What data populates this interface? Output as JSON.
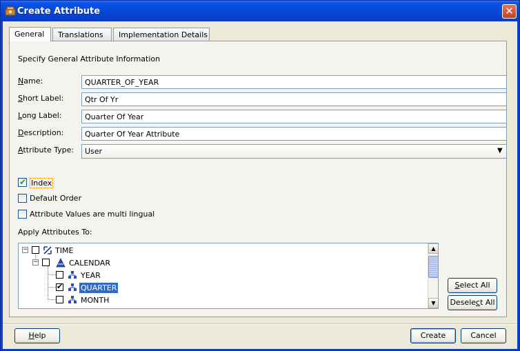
{
  "window": {
    "title": "Create Attribute",
    "close_label": "✕"
  },
  "tabs": [
    {
      "label": "General",
      "active": true
    },
    {
      "label": "Translations",
      "active": false
    },
    {
      "label": "Implementation Details",
      "active": false
    }
  ],
  "section_title": "Specify General Attribute Information",
  "fields": {
    "name": {
      "label_mn": "N",
      "label_rest": "ame:",
      "value": "QUARTER_OF_YEAR"
    },
    "short_label": {
      "label_mn": "S",
      "label_rest": "hort Label:",
      "value": "Qtr Of Yr"
    },
    "long_label": {
      "label_mn": "L",
      "label_rest": "ong Label:",
      "value": "Quarter Of Year"
    },
    "description": {
      "label_mn": "D",
      "label_rest": "escription:",
      "value": "Quarter Of Year Attribute"
    },
    "attribute_type": {
      "label_mn": "A",
      "label_rest": "ttribute Type:",
      "value": "User"
    }
  },
  "checkboxes": {
    "index": {
      "label_mn": "I",
      "label_rest": "ndex",
      "checked": true
    },
    "default_order": {
      "label_pre": "Default ",
      "label_mn": "O",
      "label_rest": "rder",
      "checked": false
    },
    "multilingual": {
      "label_pre": "Attribute ",
      "label_mn": "V",
      "label_rest": "alues are multi lingual",
      "checked": false
    }
  },
  "apply_label": "Apply Attributes To:",
  "tree": {
    "nodes": [
      {
        "label": "TIME",
        "icon": "dimension-icon",
        "checked": false,
        "level": 0
      },
      {
        "label": "CALENDAR",
        "icon": "hierarchy-icon",
        "checked": false,
        "level": 1
      },
      {
        "label": "YEAR",
        "icon": "level-icon",
        "checked": false,
        "level": 2
      },
      {
        "label": "QUARTER",
        "icon": "level-icon",
        "checked": true,
        "level": 2,
        "selected": true
      },
      {
        "label": "MONTH",
        "icon": "level-icon",
        "checked": false,
        "level": 2
      }
    ]
  },
  "buttons": {
    "select_all": {
      "pre": "",
      "mn": "S",
      "rest": "elect All"
    },
    "deselect_all": {
      "pre": "Desele",
      "mn": "c",
      "rest": "t All"
    },
    "help": {
      "pre": "",
      "mn": "H",
      "rest": "elp"
    },
    "create": "Create",
    "cancel": "Cancel"
  },
  "colors": {
    "title_bar": "#0a52e6",
    "selection": "#316ac5",
    "background": "#ece9d8",
    "check_green": "#21a121"
  }
}
